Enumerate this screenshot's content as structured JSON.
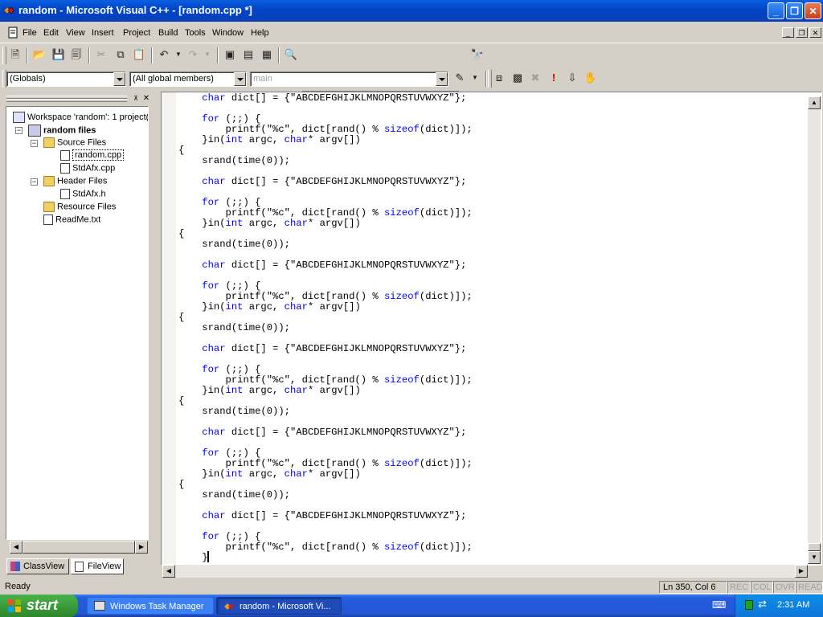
{
  "window": {
    "title": "random - Microsoft Visual C++ - [random.cpp *]",
    "minimize": "_",
    "restore": "❐",
    "close": "✕"
  },
  "menu": {
    "items": [
      "File",
      "Edit",
      "View",
      "Insert",
      "Project",
      "Build",
      "Tools",
      "Window",
      "Help"
    ]
  },
  "toolbar": {
    "find_combo_value": "",
    "globals_combo": "(Globals)",
    "members_combo": "(All global members)",
    "function_combo": "main"
  },
  "workspace": {
    "tree": [
      {
        "label": "Workspace 'random': 1 project(",
        "icon": "workspace-icon",
        "bold": false
      },
      {
        "label": "random files",
        "icon": "project-icon",
        "bold": true
      },
      {
        "label": "Source Files",
        "icon": "folder-icon"
      },
      {
        "label": "random.cpp",
        "icon": "cpp-file-icon",
        "selected": true
      },
      {
        "label": "StdAfx.cpp",
        "icon": "cpp-file-icon"
      },
      {
        "label": "Header Files",
        "icon": "folder-icon"
      },
      {
        "label": "StdAfx.h",
        "icon": "h-file-icon"
      },
      {
        "label": "Resource Files",
        "icon": "folder-icon"
      },
      {
        "label": "ReadMe.txt",
        "icon": "txt-file-icon"
      }
    ],
    "tabs": [
      "ClassView",
      "FileView"
    ],
    "active_tab": "FileView"
  },
  "editor": {
    "lines": [
      "    char dict[] = {\"ABCDEFGHIJKLMNOPQRSTUVWXYZ\"};",
      "",
      "    for (;;) {",
      "        printf(\"%c\", dict[rand() % sizeof(dict)]);",
      "    }in(int argc, char* argv[])",
      "{",
      "    srand(time(0));",
      "",
      "    char dict[] = {\"ABCDEFGHIJKLMNOPQRSTUVWXYZ\"};",
      "",
      "    for (;;) {",
      "        printf(\"%c\", dict[rand() % sizeof(dict)]);",
      "    }in(int argc, char* argv[])",
      "{",
      "    srand(time(0));",
      "",
      "    char dict[] = {\"ABCDEFGHIJKLMNOPQRSTUVWXYZ\"};",
      "",
      "    for (;;) {",
      "        printf(\"%c\", dict[rand() % sizeof(dict)]);",
      "    }in(int argc, char* argv[])",
      "{",
      "    srand(time(0));",
      "",
      "    char dict[] = {\"ABCDEFGHIJKLMNOPQRSTUVWXYZ\"};",
      "",
      "    for (;;) {",
      "        printf(\"%c\", dict[rand() % sizeof(dict)]);",
      "    }in(int argc, char* argv[])",
      "{",
      "    srand(time(0));",
      "",
      "    char dict[] = {\"ABCDEFGHIJKLMNOPQRSTUVWXYZ\"};",
      "",
      "    for (;;) {",
      "        printf(\"%c\", dict[rand() % sizeof(dict)]);",
      "    }in(int argc, char* argv[])",
      "{",
      "    srand(time(0));",
      "",
      "    char dict[] = {\"ABCDEFGHIJKLMNOPQRSTUVWXYZ\"};",
      "",
      "    for (;;) {",
      "        printf(\"%c\", dict[rand() % sizeof(dict)]);",
      "    }"
    ],
    "keywords": [
      "char",
      "for",
      "int",
      "sizeof"
    ]
  },
  "status": {
    "message": "Ready",
    "position": "Ln 350, Col 6",
    "indicators": [
      "REC",
      "COL",
      "OVR",
      "READ"
    ]
  },
  "taskbar": {
    "start_label": "start",
    "tasks": [
      {
        "label": "Windows Task Manager",
        "active": false
      },
      {
        "label": "random - Microsoft Vi...",
        "active": true
      }
    ],
    "clock": "2:31 AM"
  },
  "colors": {
    "keyword": "#0000ff",
    "title_bar": "#0047c8",
    "taskbar": "#245ddb",
    "start_button": "#3b9c3b"
  }
}
